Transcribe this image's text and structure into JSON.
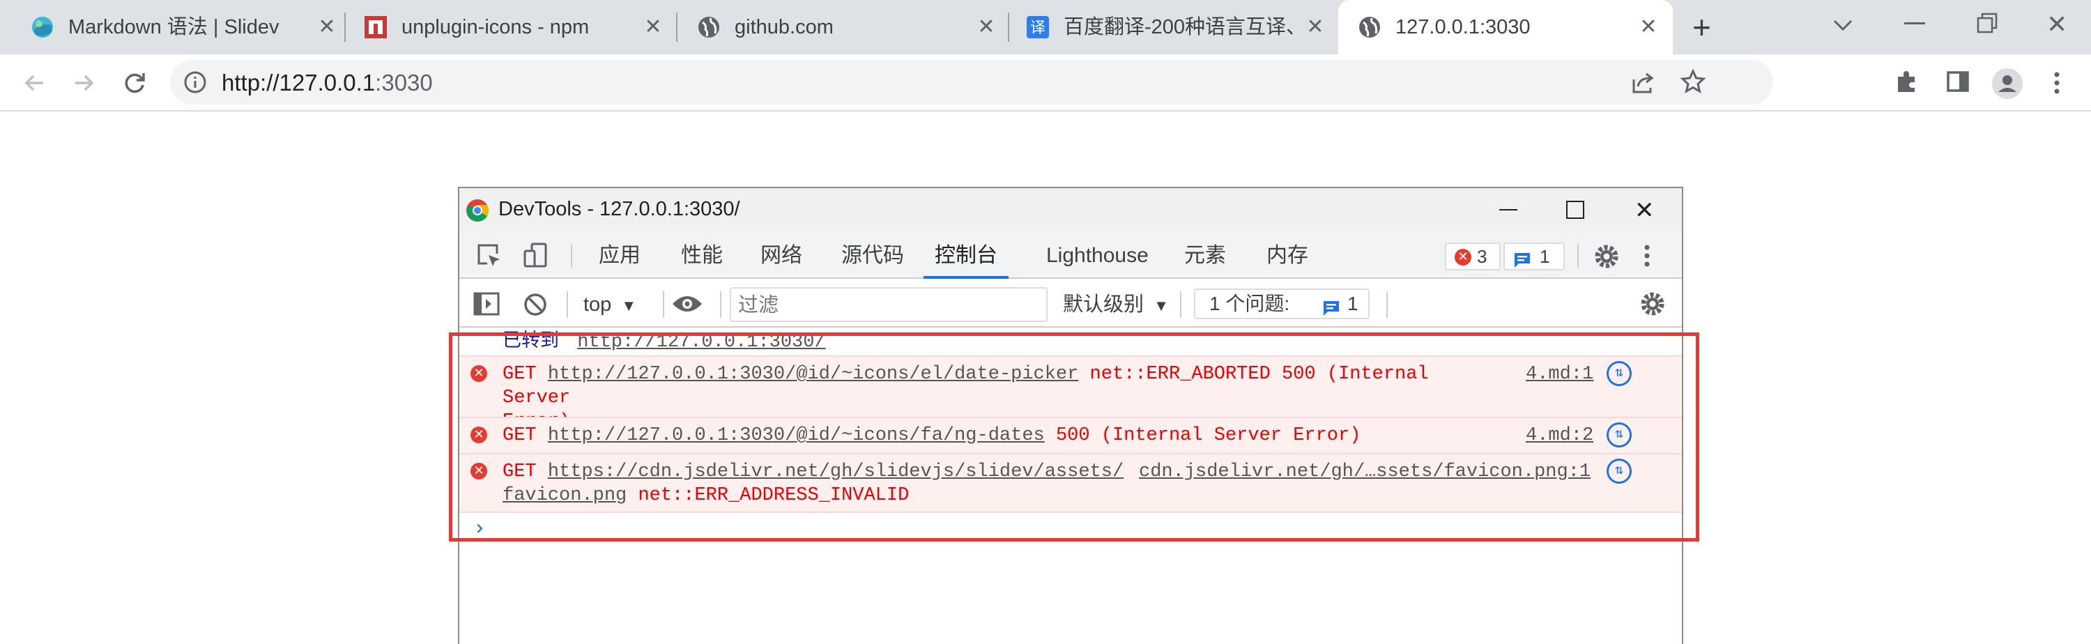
{
  "browser": {
    "tabs": [
      {
        "title": "Markdown 语法 | Slidev",
        "favicon": "slidev-logo-icon"
      },
      {
        "title": "unplugin-icons - npm",
        "favicon": "npm-logo-icon"
      },
      {
        "title": "github.com",
        "favicon": "globe-icon"
      },
      {
        "title": "百度翻译-200种语言互译、",
        "favicon": "baidu-translate-icon"
      },
      {
        "title": "127.0.0.1:3030",
        "favicon": "globe-icon"
      }
    ],
    "new_tab": "+",
    "address": {
      "host": "http://127.0.0.1",
      "port": ":3030"
    }
  },
  "devtools": {
    "title": "DevTools - 127.0.0.1:3030/",
    "tabs": [
      "应用",
      "性能",
      "网络",
      "源代码",
      "控制台",
      "Lighthouse",
      "元素",
      "内存"
    ],
    "active_tab": "控制台",
    "error_count": "3",
    "message_count": "1",
    "console": {
      "context": "top",
      "filter_placeholder": "过滤",
      "level": "默认级别",
      "issues_label": "1 个问题:",
      "issues_count": "1"
    },
    "messages": [
      {
        "type": "info",
        "prefix": "已转到",
        "url": "http://127.0.0.1:3030/"
      },
      {
        "type": "error",
        "method": "GET",
        "url": "http://127.0.0.1:3030/@id/~icons/el/date-picker",
        "status": "net::ERR_ABORTED 500 (Internal Server",
        "status2": "Error)",
        "source": "4.md:1"
      },
      {
        "type": "error",
        "method": "GET",
        "url": "http://127.0.0.1:3030/@id/~icons/fa/ng-dates",
        "status": "500 (Internal Server Error)",
        "source": "4.md:2"
      },
      {
        "type": "error",
        "method": "GET",
        "url": "https://cdn.jsdelivr.net/gh/slidevjs/slidev/assets/",
        "url2": "favicon.png",
        "status": "net::ERR_ADDRESS_INVALID",
        "source": "cdn.jsdelivr.net/gh/…ssets/favicon.png:1"
      }
    ],
    "prompt": "›"
  }
}
